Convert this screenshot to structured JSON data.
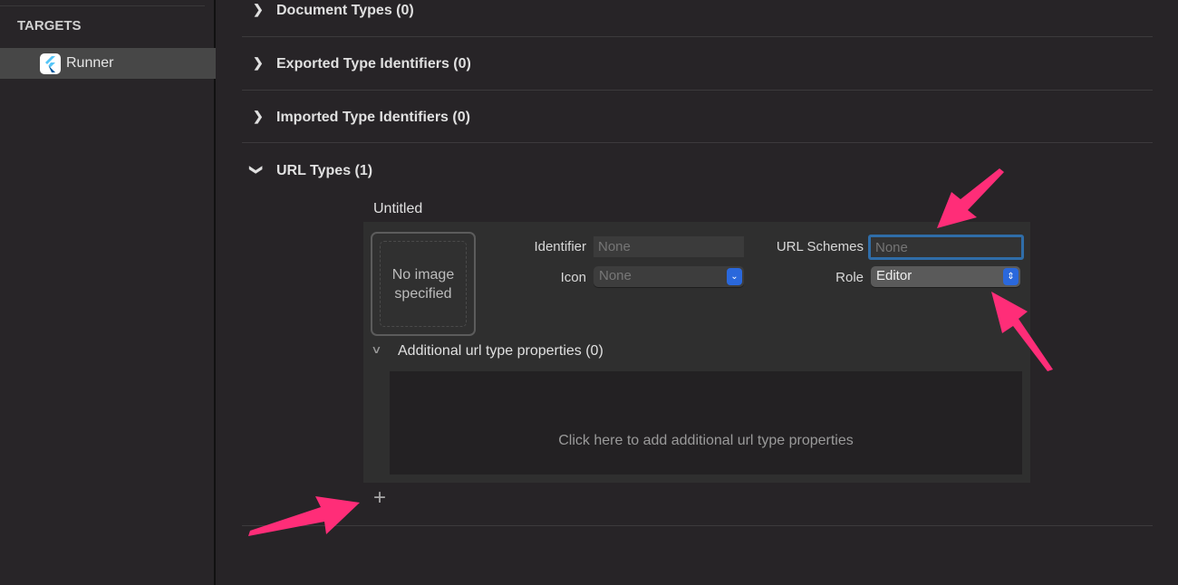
{
  "sidebar": {
    "header": "TARGETS",
    "items": [
      {
        "label": "Runner",
        "icon": "flutter-app-icon",
        "selected": true
      }
    ]
  },
  "sections": [
    {
      "title": "Document Types (0)",
      "expanded": false
    },
    {
      "title": "Exported Type Identifiers (0)",
      "expanded": false
    },
    {
      "title": "Imported Type Identifiers (0)",
      "expanded": false
    },
    {
      "title": "URL Types (1)",
      "expanded": true
    }
  ],
  "url_type": {
    "name": "Untitled",
    "image_placeholder": "No image specified",
    "identifier_label": "Identifier",
    "identifier_placeholder": "None",
    "icon_label": "Icon",
    "icon_value": "None",
    "url_schemes_label": "URL Schemes",
    "url_schemes_placeholder": "None",
    "role_label": "Role",
    "role_value": "Editor",
    "additional_title": "Additional url type properties (0)",
    "additional_hint": "Click here to add additional url type properties"
  },
  "add_button": "+",
  "colors": {
    "accent": "#2a68dc",
    "focus_ring": "#2f6da8",
    "annotation_arrow": "#ff2d78"
  }
}
